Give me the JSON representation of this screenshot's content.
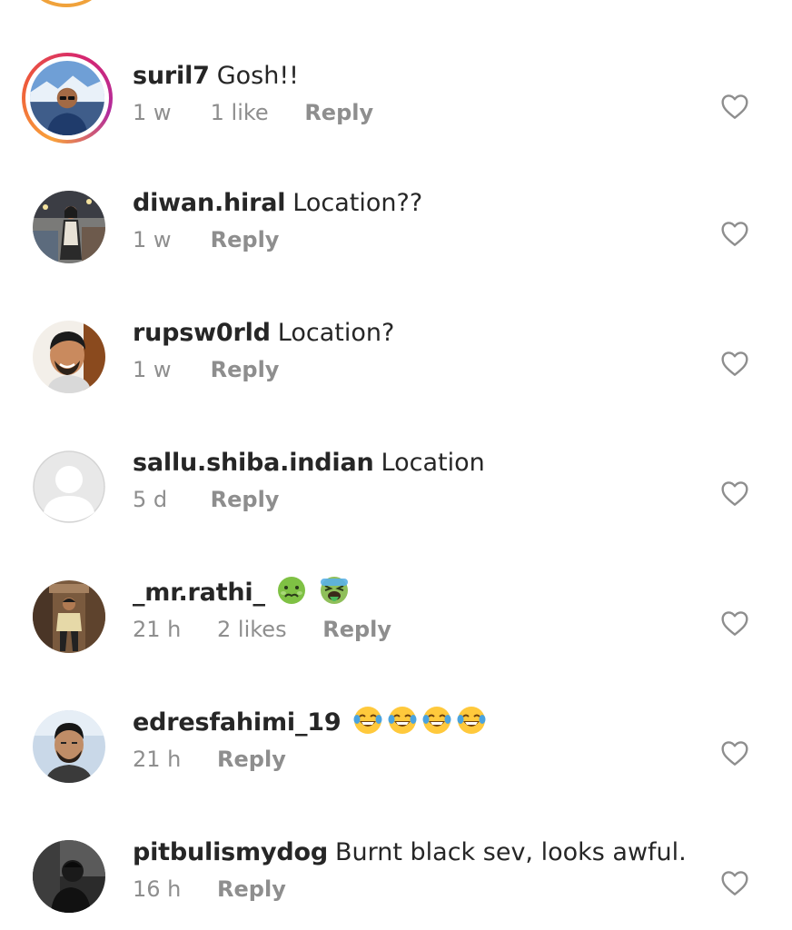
{
  "comments": [
    {
      "username": "suril7",
      "text": "Gosh!!",
      "emojis": [],
      "time": "1 w",
      "likes": "1 like",
      "reply": "Reply",
      "has_story": true
    },
    {
      "username": "diwan.hiral",
      "text": "Location??",
      "emojis": [],
      "time": "1 w",
      "likes": "",
      "reply": "Reply",
      "has_story": false
    },
    {
      "username": "rupsw0rld",
      "text": "Location?",
      "emojis": [],
      "time": "1 w",
      "likes": "",
      "reply": "Reply",
      "has_story": false
    },
    {
      "username": "sallu.shiba.indian",
      "text": "Location",
      "emojis": [],
      "time": "5 d",
      "likes": "",
      "reply": "Reply",
      "has_story": false
    },
    {
      "username": "_mr.rathi_",
      "text": "",
      "emojis": [
        "nauseated-face-emoji",
        "vomiting-face-emoji"
      ],
      "time": "21 h",
      "likes": "2 likes",
      "reply": "Reply",
      "has_story": false
    },
    {
      "username": "edresfahimi_19",
      "text": "",
      "emojis": [
        "tears-of-joy-emoji",
        "tears-of-joy-emoji",
        "tears-of-joy-emoji",
        "tears-of-joy-emoji"
      ],
      "time": "21 h",
      "likes": "",
      "reply": "Reply",
      "has_story": false
    },
    {
      "username": "pitbulismydog",
      "text": "Burnt black sev, looks awful.",
      "emojis": [],
      "time": "16 h",
      "likes": "",
      "reply": "Reply",
      "has_story": false
    }
  ],
  "colors": {
    "text_primary": "#262626",
    "text_secondary": "#8e8e8e",
    "story_ring": [
      "#f9a13a",
      "#ee5a3a",
      "#d6276f",
      "#b12b9e"
    ]
  },
  "icons": {
    "like": "heart-outline-icon"
  }
}
